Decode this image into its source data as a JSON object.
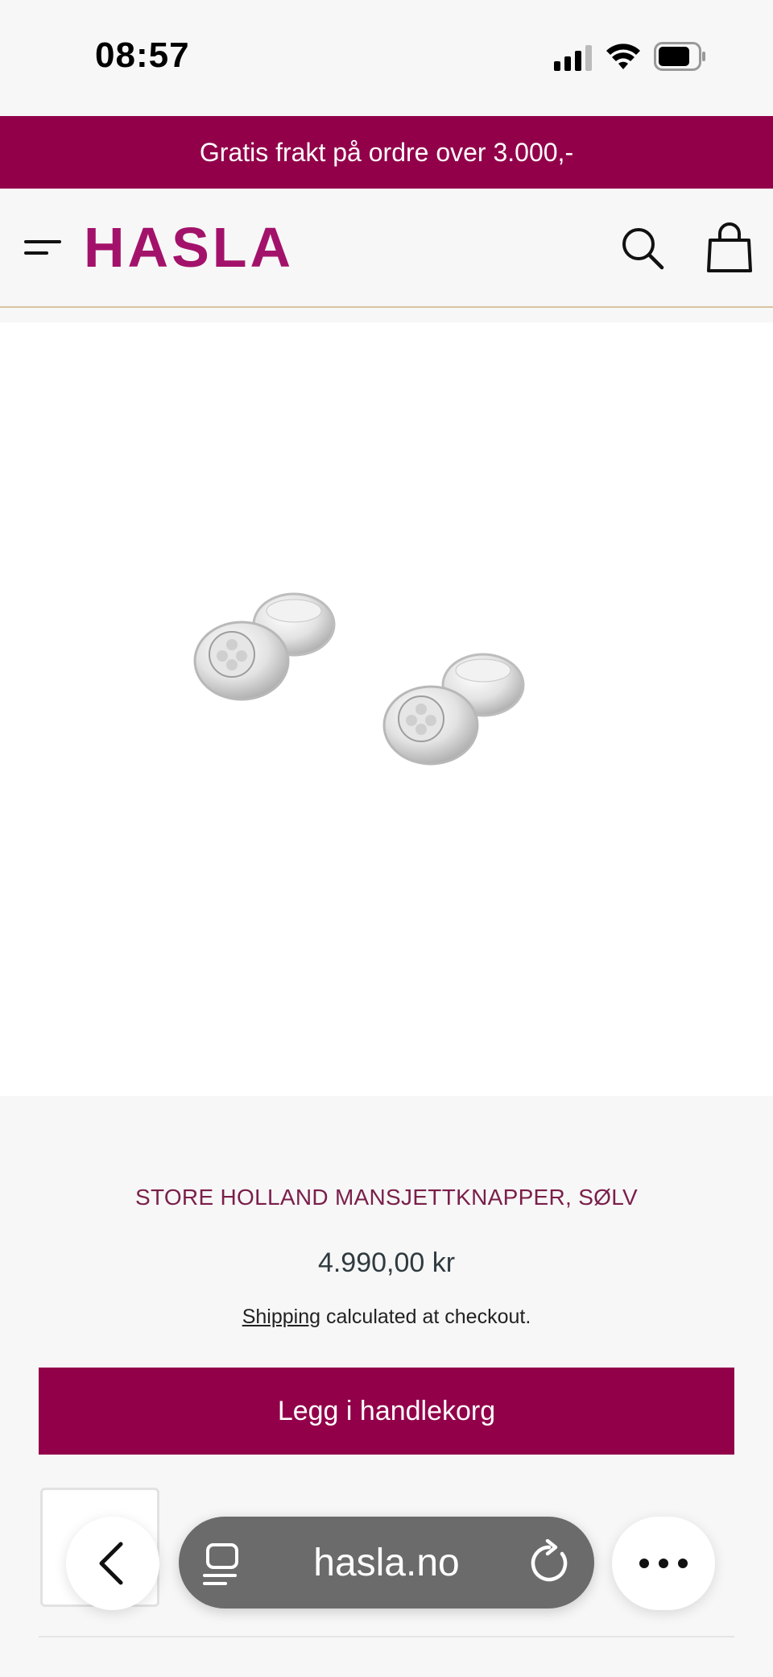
{
  "status_bar": {
    "time": "08:57"
  },
  "announcement": {
    "text": "Gratis frakt på ordre over 3.000,-"
  },
  "header": {
    "logo": "HASLA"
  },
  "product": {
    "title": "STORE HOLLAND MANSJETTKNAPPER, SØLV",
    "price": "4.990,00 kr",
    "shipping_link": "Shipping",
    "shipping_suffix": " calculated at checkout.",
    "add_to_cart": "Legg i handlekorg"
  },
  "browser": {
    "url": "hasla.no"
  },
  "colors": {
    "brand": "#92004a",
    "logo": "#a3126a",
    "accent_line": "#d9c3a1"
  }
}
